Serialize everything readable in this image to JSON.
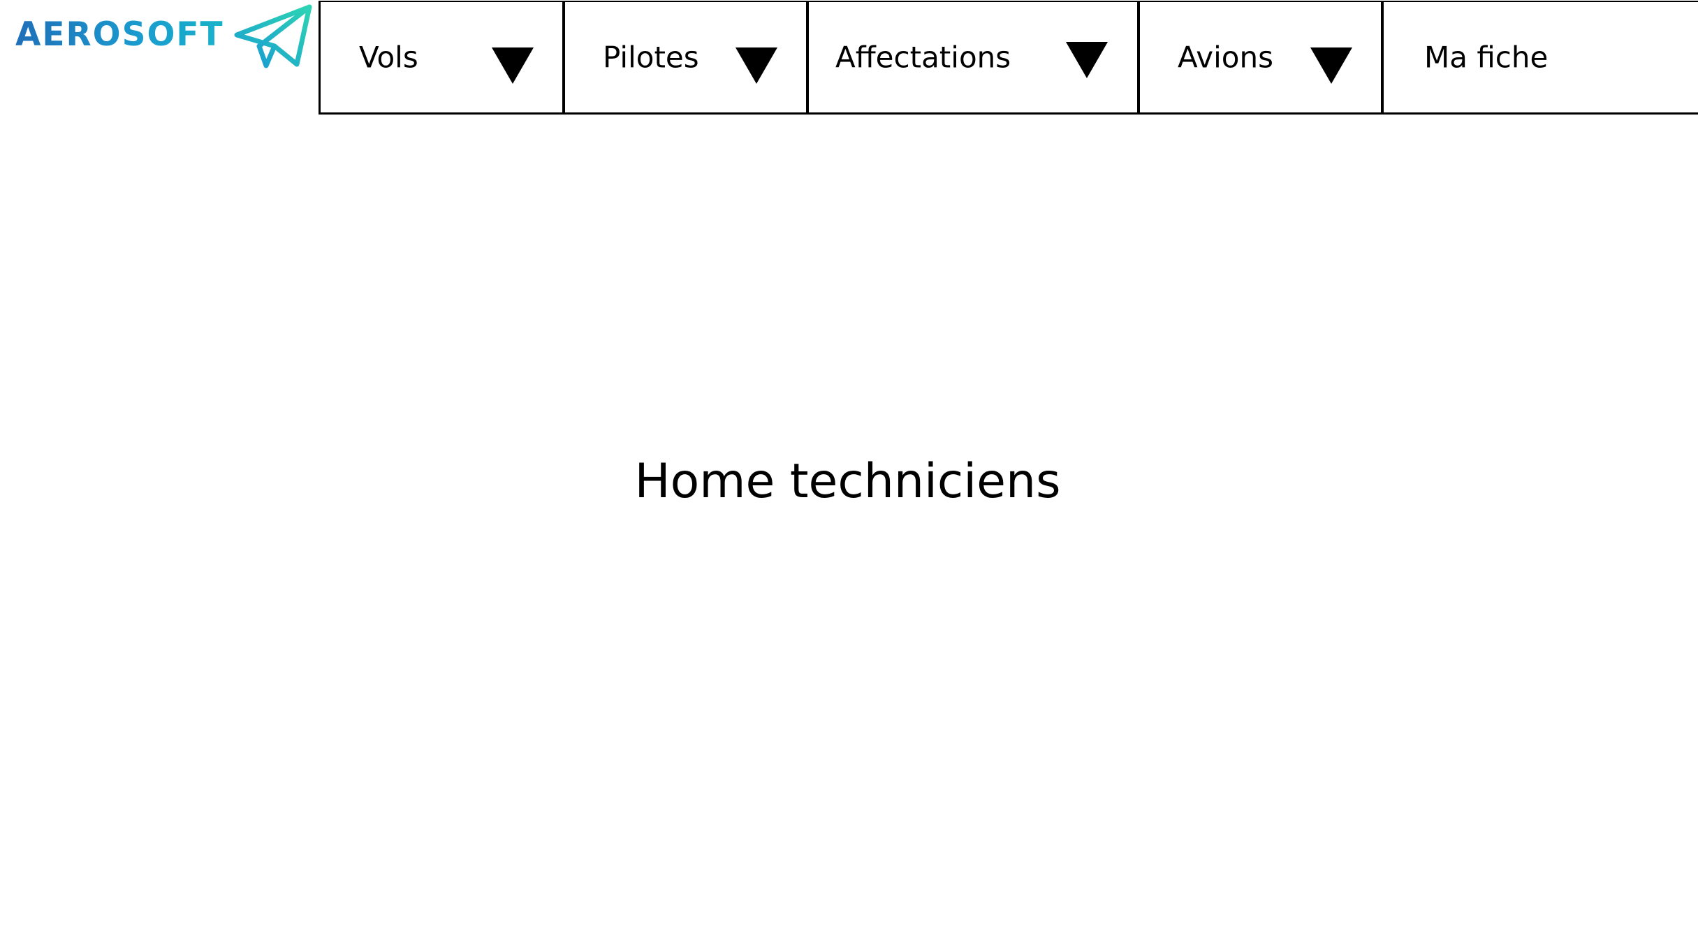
{
  "brand": {
    "name": "AEROSOFT",
    "icon": "paper-plane-icon",
    "colors": {
      "primary": "#1e6fb8",
      "accent": "#17b3c9"
    }
  },
  "nav": {
    "items": [
      {
        "label": "Vols",
        "has_dropdown": true,
        "icon": "caret-down-icon"
      },
      {
        "label": "Pilotes",
        "has_dropdown": true,
        "icon": "caret-down-icon"
      },
      {
        "label": "Affectations",
        "has_dropdown": true,
        "icon": "caret-down-icon"
      },
      {
        "label": "Avions",
        "has_dropdown": true,
        "icon": "caret-down-icon"
      },
      {
        "label": "Ma fiche",
        "has_dropdown": false
      }
    ]
  },
  "main": {
    "title": "Home techniciens"
  }
}
